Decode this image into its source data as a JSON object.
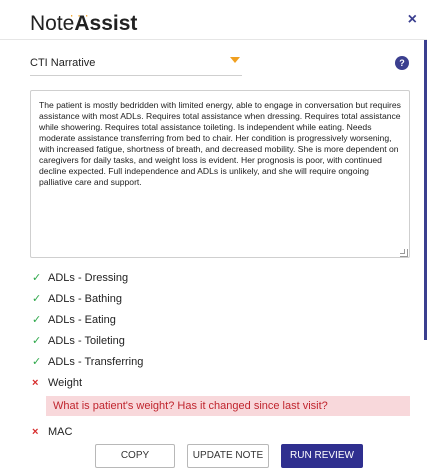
{
  "header": {
    "logo_light": "Note",
    "logo_bold": "Assist",
    "logo_dots": "· · ·",
    "close_label": "×"
  },
  "narrative_select": {
    "value": "CTI Narrative",
    "help_label": "?"
  },
  "narrative_text": "The patient is mostly bedridden with limited energy, able to engage in conversation but requires assistance with most ADLs. Requires total assistance when dressing. Requires total assistance while showering. Requires total assistance toileting. Is independent while eating. Needs moderate assistance transferring from bed to chair. Her condition is progressively worsening, with increased fatigue, shortness of breath, and decreased mobility. She is more dependent on caregivers for daily tasks, and weight loss is evident. Her prognosis is poor, with continued decline expected. Full independence and ADLs is unlikely, and she will require ongoing palliative care and support.",
  "checklist": [
    {
      "label": "ADLs - Dressing",
      "status": "ok",
      "mark": "✓"
    },
    {
      "label": "ADLs - Bathing",
      "status": "ok",
      "mark": "✓"
    },
    {
      "label": "ADLs - Eating",
      "status": "ok",
      "mark": "✓"
    },
    {
      "label": "ADLs - Toileting",
      "status": "ok",
      "mark": "✓"
    },
    {
      "label": "ADLs - Transferring",
      "status": "ok",
      "mark": "✓"
    },
    {
      "label": "Weight",
      "status": "missing",
      "mark": "×",
      "alert": "What is patient's weight? Has it changed since last visit?"
    },
    {
      "label": "MAC",
      "status": "missing",
      "mark": "×",
      "alert": ""
    }
  ],
  "footer": {
    "copy_label": "COPY",
    "update_label": "UPDATE NOTE",
    "review_label": "RUN REVIEW"
  },
  "colors": {
    "accent": "#3b3f8f",
    "caret": "#f0a020",
    "ok": "#2ea84a",
    "error": "#d62b2b",
    "alert_bg": "#f8d8db"
  }
}
